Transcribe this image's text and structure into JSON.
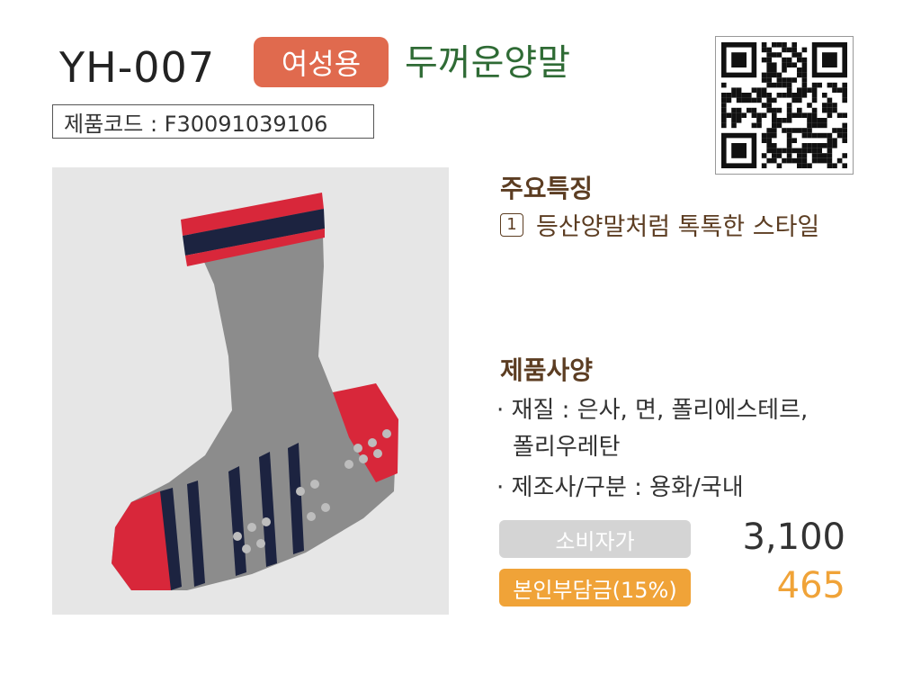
{
  "header": {
    "model": "YH-007",
    "gender_badge": "여성용",
    "product_name": "두꺼운양말"
  },
  "product_code": "제품코드 : F30091039106",
  "features": {
    "title": "주요특징",
    "items": [
      {
        "num": "1",
        "text": "등산양말처럼 톡톡한 스타일"
      }
    ]
  },
  "specs": {
    "title": "제품사양",
    "material_line1": "· 재질 : 은사, 면, 폴리에스테르,",
    "material_line2": "폴리우레탄",
    "maker": "· 제조사/구분 : 용화/국내"
  },
  "prices": {
    "retail_label": "소비자가",
    "retail_value": "3,100",
    "copay_label": "본인부담금(15%)",
    "copay_value": "465"
  },
  "colors": {
    "badge": "#e06a4e",
    "product_name": "#2f6b35",
    "section": "#5c3d22",
    "retail_label_bg": "#d4d4d4",
    "copay_label_bg": "#f0a338",
    "copay_value": "#f0a338"
  }
}
